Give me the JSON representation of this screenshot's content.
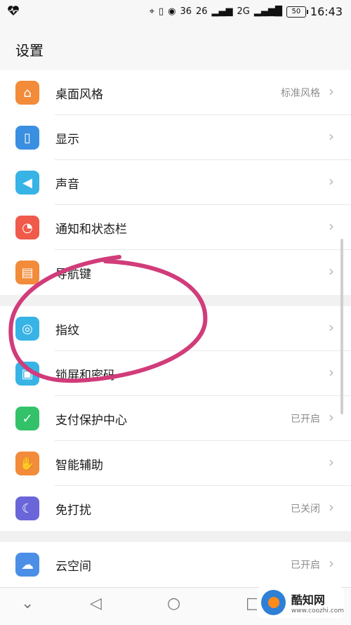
{
  "status_bar": {
    "left_icon": "heart-pulse-icon",
    "network_top": "36",
    "network_bottom": "26",
    "network_2": "2G",
    "battery": "50",
    "time": "16:43"
  },
  "header": {
    "title": "设置"
  },
  "groups": [
    {
      "items": [
        {
          "label": "桌面风格",
          "value": "标准风格",
          "icon": "home-icon",
          "color": "#f28b3a"
        },
        {
          "label": "显示",
          "value": "",
          "icon": "display-icon",
          "color": "#3b8fe0"
        },
        {
          "label": "声音",
          "value": "",
          "icon": "speaker-icon",
          "color": "#37b3e6"
        },
        {
          "label": "通知和状态栏",
          "value": "",
          "icon": "bell-icon",
          "color": "#ef5a4a"
        },
        {
          "label": "导航键",
          "value": "",
          "icon": "navigation-key-icon",
          "color": "#f28b3a"
        }
      ]
    },
    {
      "items": [
        {
          "label": "指纹",
          "value": "",
          "icon": "fingerprint-icon",
          "color": "#37b3e6"
        },
        {
          "label": "锁屏和密码",
          "value": "",
          "icon": "lock-icon",
          "color": "#37b3e6"
        },
        {
          "label": "支付保护中心",
          "value": "已开启",
          "icon": "shield-check-icon",
          "color": "#33c26a"
        },
        {
          "label": "智能辅助",
          "value": "",
          "icon": "hand-icon",
          "color": "#f28b3a"
        },
        {
          "label": "免打扰",
          "value": "已关闭",
          "icon": "moon-icon",
          "color": "#6a66d9"
        }
      ]
    },
    {
      "items": [
        {
          "label": "云空间",
          "value": "已开启",
          "icon": "cloud-icon",
          "color": "#4b8ee6"
        }
      ]
    }
  ],
  "nav": {
    "back": "back-icon",
    "home": "home-circle-icon",
    "recents": "recents-icon",
    "collapse": "chevron-down-icon"
  },
  "watermark": {
    "brand": "酷知网",
    "url": "www.coozhi.com"
  },
  "annotation_color": "#d13c7a"
}
